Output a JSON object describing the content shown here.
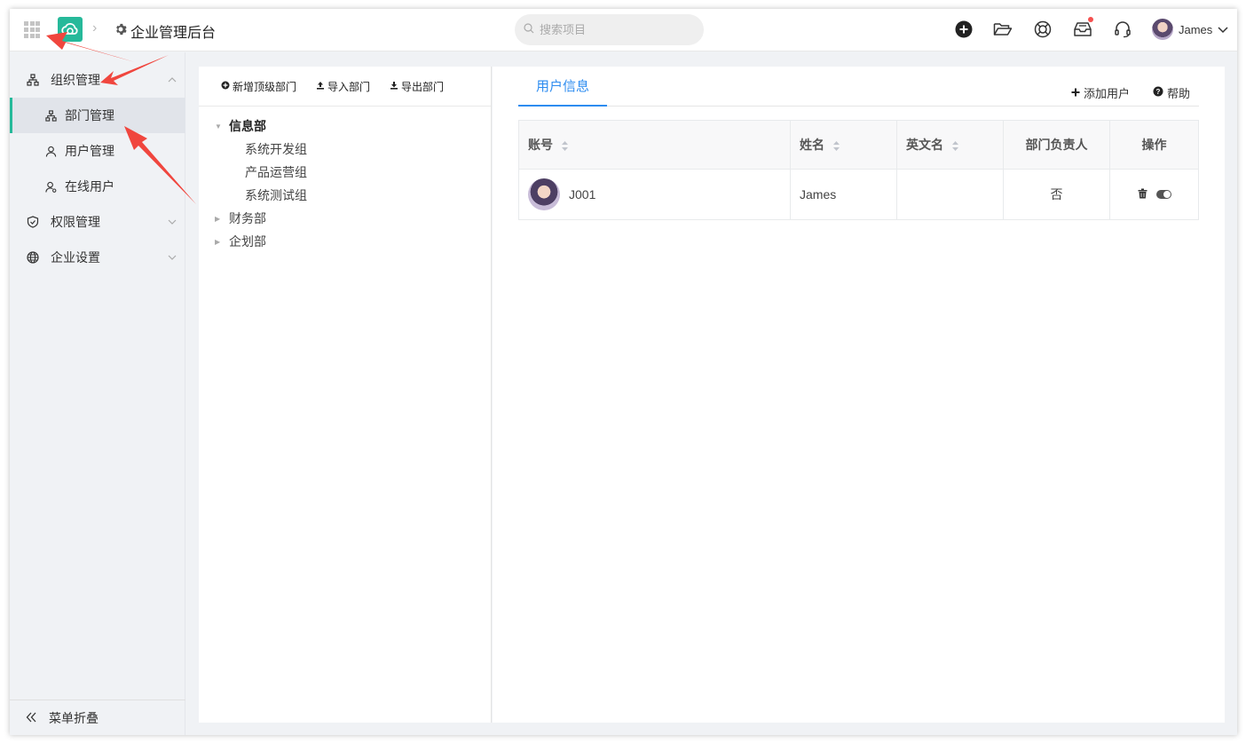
{
  "header": {
    "app_title": "企业管理后台",
    "search_placeholder": "搜索项目",
    "user_name": "James"
  },
  "sidebar": {
    "groups": [
      {
        "label": "组织管理",
        "expanded": true,
        "icon": "org-chart-icon"
      },
      {
        "label": "权限管理",
        "expanded": false,
        "icon": "shield-check-icon"
      },
      {
        "label": "企业设置",
        "expanded": false,
        "icon": "globe-icon"
      }
    ],
    "sub_items": [
      {
        "label": "部门管理",
        "active": true,
        "icon": "org-chart-icon"
      },
      {
        "label": "用户管理",
        "active": false,
        "icon": "user-icon"
      },
      {
        "label": "在线用户",
        "active": false,
        "icon": "user-online-icon"
      }
    ],
    "collapse_label": "菜单折叠"
  },
  "dept_panel": {
    "toolbar": {
      "add_top": "新增顶级部门",
      "import": "导入部门",
      "export": "导出部门"
    },
    "tree": [
      {
        "label": "信息部",
        "expanded": true,
        "children": [
          "系统开发组",
          "产品运营组",
          "系统测试组"
        ]
      },
      {
        "label": "财务部",
        "expanded": false,
        "children": []
      },
      {
        "label": "企划部",
        "expanded": false,
        "children": []
      }
    ]
  },
  "user_panel": {
    "tab": "用户信息",
    "add_user": "添加用户",
    "help": "帮助",
    "columns": [
      "账号",
      "姓名",
      "英文名",
      "部门负责人",
      "操作"
    ],
    "rows": [
      {
        "account": "J001",
        "name": "James",
        "english_name": "",
        "is_leader": "否"
      }
    ]
  },
  "colors": {
    "accent_green": "#26b99a",
    "tab_blue": "#2d8cf0",
    "annotation_red": "#f0463e"
  }
}
